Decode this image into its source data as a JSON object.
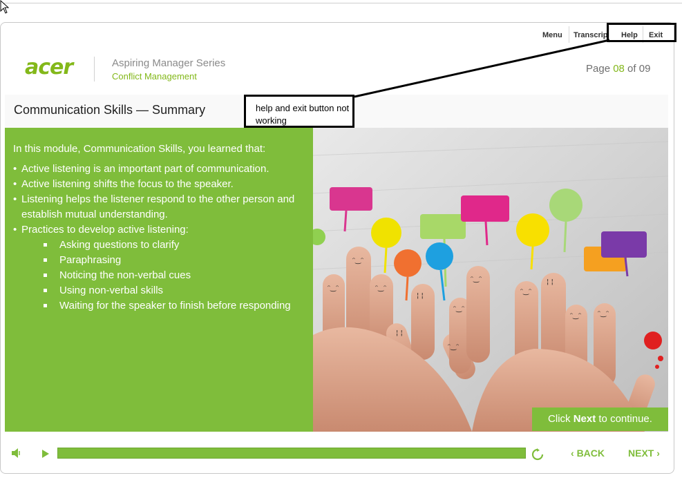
{
  "top_nav": {
    "menu": "Menu",
    "transcript": "Transcrip",
    "help": "Help",
    "exit": "Exit"
  },
  "header": {
    "logo_text": "acer",
    "series": "Aspiring Manager Series",
    "module": "Conflict Management",
    "page": {
      "prefix": "Page ",
      "current": "08",
      "separator": " of ",
      "total": "09"
    }
  },
  "slide": {
    "title": "Communication Skills — Summary",
    "intro": "In this module, Communication Skills, you learned that:",
    "bullets": [
      "Active listening is an important part of communication.",
      "Active listening shifts the focus to the speaker.",
      "Listening helps the listener respond to the other person and establish mutual understanding.",
      "Practices to develop active listening:"
    ],
    "practices": [
      "Asking questions to clarify",
      "Paraphrasing",
      "Noticing the non-verbal cues",
      "Using non-verbal skills",
      "Waiting for the speaker to finish before responding"
    ],
    "cta": {
      "prefix": "Click ",
      "bold": "Next",
      "suffix": " to continue."
    }
  },
  "annotation": {
    "note": "help and exit button not working"
  },
  "controls": {
    "volume_icon": "speaker-icon",
    "play_icon": "play-icon",
    "replay_icon": "replay-icon",
    "progress": 1.0,
    "back": "BACK",
    "next": "NEXT"
  },
  "colors": {
    "brand_green": "#83b81a",
    "panel_green": "#7fbd3b"
  }
}
